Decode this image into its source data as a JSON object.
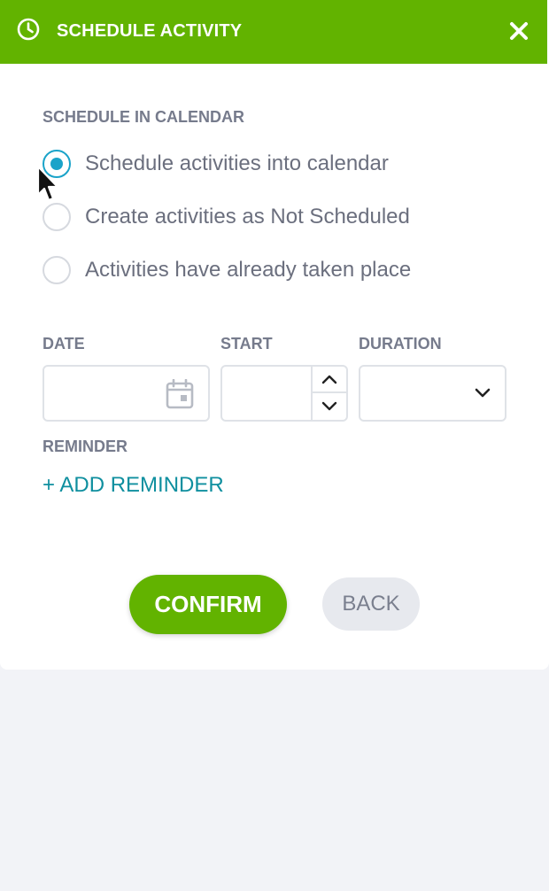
{
  "header": {
    "title": "SCHEDULE ACTIVITY",
    "clock_icon": "clock-icon",
    "close_icon": "close-icon",
    "color": "#62b300"
  },
  "schedule": {
    "section_label": "SCHEDULE IN CALENDAR",
    "options": [
      {
        "label": "Schedule activities into calendar",
        "checked": true
      },
      {
        "label": "Create activities as Not Scheduled",
        "checked": false
      },
      {
        "label": "Activities have already taken place",
        "checked": false
      }
    ],
    "accent": "#1aa3c9"
  },
  "fields": {
    "date_label": "DATE",
    "date_value": "",
    "date_icon": "calendar-icon",
    "start_label": "START",
    "start_value": "",
    "duration_label": "DURATION",
    "duration_value": ""
  },
  "reminder": {
    "label": "REMINDER",
    "add_link": "+ ADD REMINDER",
    "link_color": "#0f8f9f"
  },
  "actions": {
    "confirm_label": "CONFIRM",
    "back_label": "BACK"
  }
}
